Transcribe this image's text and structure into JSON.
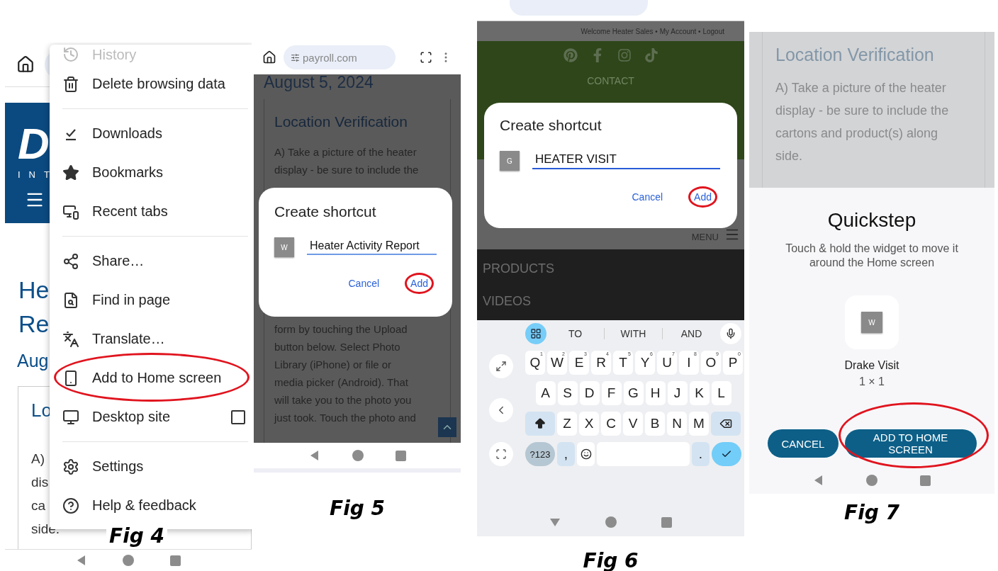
{
  "figure_4": {
    "caption": "Fig 4",
    "page": {
      "logo_text": "D",
      "logo_subtext": "INT",
      "heading_lines": [
        "He",
        "Re"
      ],
      "date_fragment": "Aug",
      "card_title_fragment": "Lo",
      "card_lines": [
        "A)",
        "dis",
        "ca",
        "side."
      ]
    },
    "menu": [
      {
        "kind": "item",
        "label": "History",
        "dimmed": true,
        "circled": false,
        "divider_after": false
      },
      {
        "kind": "item",
        "label": "Delete browsing data",
        "dimmed": false,
        "circled": false,
        "divider_after": true
      },
      {
        "kind": "item",
        "label": "Downloads",
        "dimmed": false,
        "circled": false,
        "divider_after": false
      },
      {
        "kind": "item",
        "label": "Bookmarks",
        "dimmed": false,
        "circled": false,
        "divider_after": false
      },
      {
        "kind": "item",
        "label": "Recent tabs",
        "dimmed": false,
        "circled": false,
        "divider_after": true
      },
      {
        "kind": "item",
        "label": "Share…",
        "dimmed": false,
        "circled": false,
        "divider_after": false
      },
      {
        "kind": "item",
        "label": "Find in page",
        "dimmed": false,
        "circled": false,
        "divider_after": false
      },
      {
        "kind": "item",
        "label": "Translate…",
        "dimmed": false,
        "circled": false,
        "divider_after": false
      },
      {
        "kind": "item",
        "label": "Add to Home screen",
        "dimmed": false,
        "circled": true,
        "divider_after": false
      },
      {
        "kind": "checkbox",
        "label": "Desktop site",
        "checked": false,
        "dimmed": false,
        "circled": false,
        "divider_after": true
      },
      {
        "kind": "item",
        "label": "Settings",
        "dimmed": false,
        "circled": false,
        "divider_after": false
      },
      {
        "kind": "item",
        "label": "Help & feedback",
        "dimmed": false,
        "circled": false,
        "divider_after": false
      }
    ]
  },
  "figure_5": {
    "caption": "Fig 5",
    "url": "payroll.com",
    "page": {
      "date": "August 5, 2024",
      "card_title": "Location Verification",
      "lines_above": [
        "A) Take a picture of the heater",
        "display - be sure to include the"
      ],
      "lines_below": [
        "form by touching the Upload",
        "button below. Select Photo",
        "Library (iPhone) or file or",
        "media picker (Android). That",
        "will take you to the photo you",
        "just took. Touch the photo and"
      ]
    },
    "dialog": {
      "title": "Create shortcut",
      "icon_letter": "W",
      "name": "Heater Activity Report",
      "buttons": [
        {
          "label": "Cancel",
          "circled": false
        },
        {
          "label": "Add",
          "circled": true
        }
      ]
    }
  },
  "figure_6": {
    "caption": "Fig 6",
    "account_bar": "Welcome Heater Sales • My Account • Logout",
    "contact": "CONTACT",
    "dialog": {
      "title": "Create shortcut",
      "icon_letter": "G",
      "name": "HEATER VISIT",
      "buttons": [
        {
          "label": "Cancel",
          "circled": false
        },
        {
          "label": "Add",
          "circled": true
        }
      ]
    },
    "menu_label": "MENU",
    "nav_links": [
      "PRODUCTS",
      "VIDEOS"
    ],
    "keyboard": {
      "suggestions": [
        "TO",
        "WITH",
        "AND"
      ],
      "rows": [
        [
          {
            "label": "Q",
            "hint": "1"
          },
          {
            "label": "W",
            "hint": "2"
          },
          {
            "label": "E",
            "hint": "3"
          },
          {
            "label": "R",
            "hint": "4"
          },
          {
            "label": "T",
            "hint": "5"
          },
          {
            "label": "Y",
            "hint": "6"
          },
          {
            "label": "U",
            "hint": "7"
          },
          {
            "label": "I",
            "hint": "8"
          },
          {
            "label": "O",
            "hint": "9"
          },
          {
            "label": "P",
            "hint": "0"
          }
        ],
        [
          {
            "label": "A"
          },
          {
            "label": "S"
          },
          {
            "label": "D"
          },
          {
            "label": "F"
          },
          {
            "label": "G"
          },
          {
            "label": "H"
          },
          {
            "label": "J"
          },
          {
            "label": "K"
          },
          {
            "label": "L"
          }
        ],
        [
          {
            "label": "Z"
          },
          {
            "label": "X"
          },
          {
            "label": "C"
          },
          {
            "label": "V"
          },
          {
            "label": "B"
          },
          {
            "label": "N"
          },
          {
            "label": "M"
          }
        ]
      ],
      "symbols_key": "?123",
      "comma_key": ",",
      "period_key": "."
    }
  },
  "figure_7": {
    "caption": "Fig 7",
    "page": {
      "card_title": "Location Verification",
      "lines": [
        "A) Take a picture of the heater",
        "display - be sure to include the",
        "cartons and product(s) along",
        "side."
      ]
    },
    "sheet": {
      "title": "Quickstep",
      "description": "Touch & hold the widget to move it around the Home screen",
      "icon_letter": "W",
      "widget_name": "Drake Visit",
      "widget_size": "1 × 1",
      "buttons": [
        {
          "label": "CANCEL",
          "circled": false
        },
        {
          "label": "ADD TO HOME SCREEN",
          "circled": true
        }
      ]
    }
  }
}
